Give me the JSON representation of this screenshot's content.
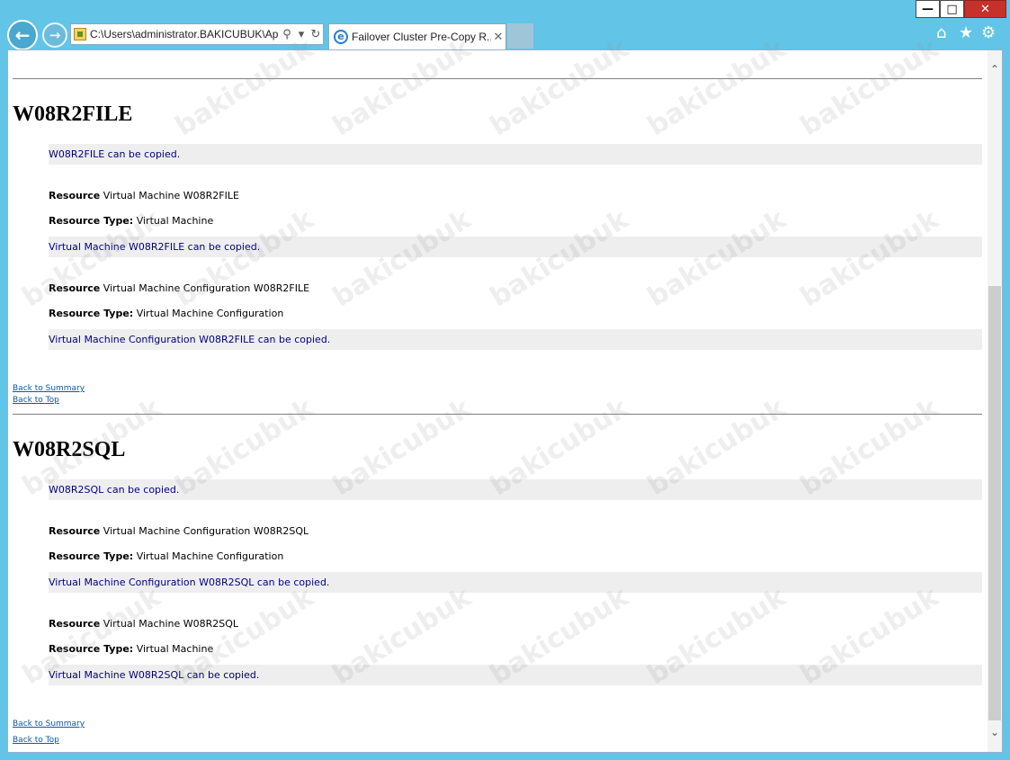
{
  "browser": {
    "address": "C:\\Users\\administrator.BAKICUBUK\\Ap",
    "tab_title": "Failover Cluster Pre-Copy R...",
    "icons": {
      "back": "back-arrow-icon",
      "forward": "forward-arrow-icon",
      "search": "search-icon",
      "dropdown": "chevron-down-icon",
      "refresh": "refresh-icon",
      "tab_close": "close-icon",
      "home": "home-icon",
      "favorites": "star-icon",
      "tools": "gear-icon"
    }
  },
  "sections": [
    {
      "host": "W08R2FILE",
      "summary": "W08R2FILE can be copied.",
      "resources": [
        {
          "resource_label": "Resource",
          "resource": "Virtual Machine W08R2FILE",
          "type_label": "Resource Type:",
          "type": "Virtual Machine",
          "message": "Virtual Machine W08R2FILE can be copied."
        },
        {
          "resource_label": "Resource",
          "resource": "Virtual Machine Configuration W08R2FILE",
          "type_label": "Resource Type:",
          "type": "Virtual Machine Configuration",
          "message": "Virtual Machine Configuration W08R2FILE can be copied."
        }
      ],
      "back_to_summary": "Back to Summary",
      "back_to_top": "Back to Top"
    },
    {
      "host": "W08R2SQL",
      "summary": "W08R2SQL can be copied.",
      "resources": [
        {
          "resource_label": "Resource",
          "resource": "Virtual Machine Configuration W08R2SQL",
          "type_label": "Resource Type:",
          "type": "Virtual Machine Configuration",
          "message": "Virtual Machine Configuration W08R2SQL can be copied."
        },
        {
          "resource_label": "Resource",
          "resource": "Virtual Machine W08R2SQL",
          "type_label": "Resource Type:",
          "type": "Virtual Machine",
          "message": "Virtual Machine W08R2SQL can be copied."
        }
      ],
      "back_to_summary": "Back to Summary",
      "back_to_top": "Back to Top"
    }
  ],
  "watermark": "bakicubuk",
  "colors": {
    "frame": "#62c4e6",
    "message_text": "#000080",
    "message_background": "#eeeeee",
    "link": "#0b59a8",
    "close_button": "#c7312b"
  }
}
